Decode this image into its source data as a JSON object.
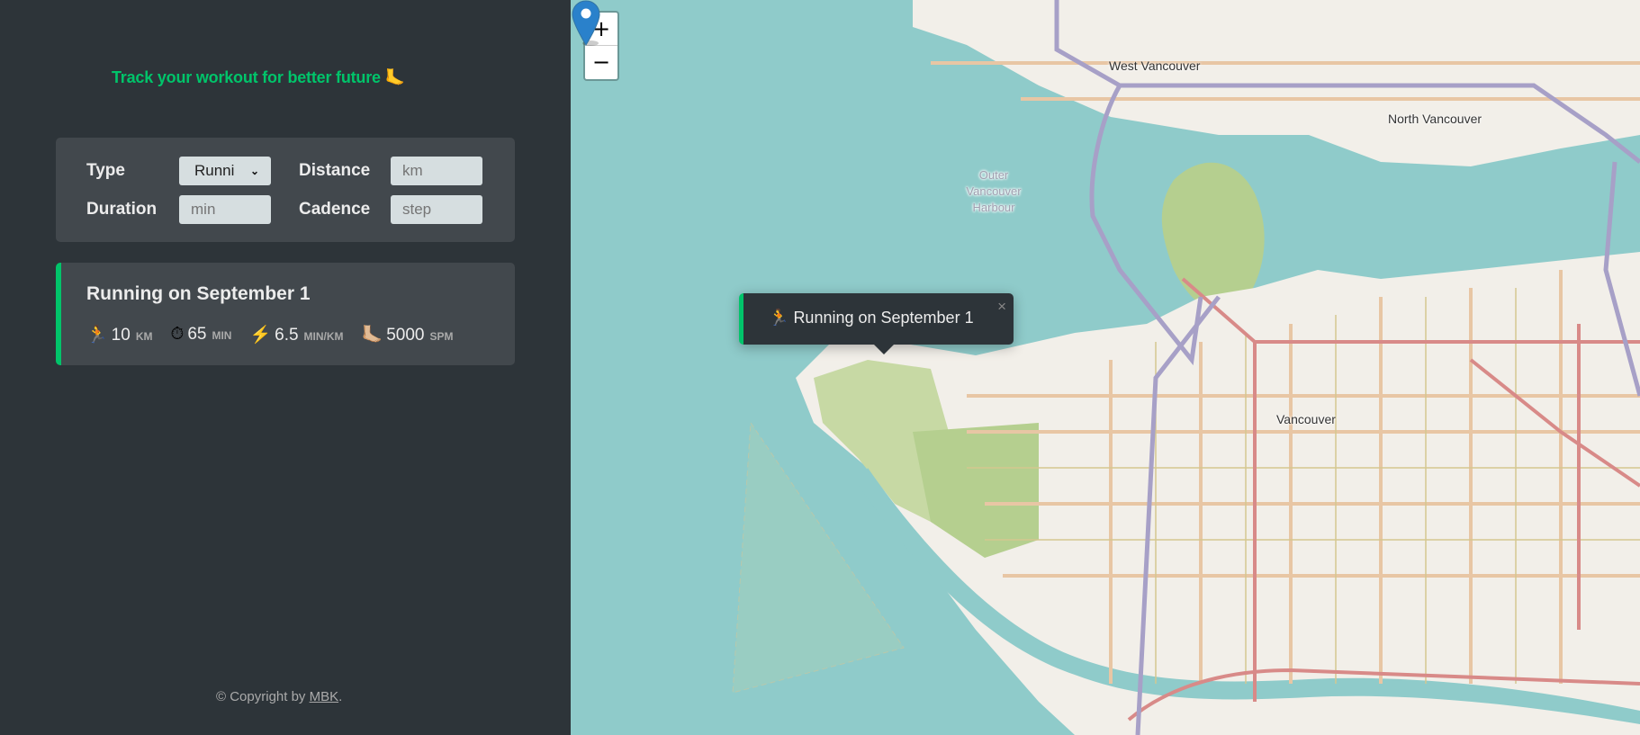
{
  "sidebar": {
    "tagline": "Track your workout for better future 🦶",
    "form": {
      "type_label": "Type",
      "type_value": "Runni",
      "distance_label": "Distance",
      "distance_placeholder": "km",
      "duration_label": "Duration",
      "duration_placeholder": "min",
      "cadence_label": "Cadence",
      "cadence_placeholder": "step"
    },
    "workouts": [
      {
        "title": "Running on September 1",
        "details": [
          {
            "icon": "🏃",
            "icon_name": "runner-icon",
            "value": "10",
            "unit": "km"
          },
          {
            "icon": "⏱",
            "icon_name": "stopwatch-icon",
            "value": "65",
            "unit": "min"
          },
          {
            "icon": "⚡️",
            "icon_name": "lightning-icon",
            "value": "6.5",
            "unit": "min/km"
          },
          {
            "icon": "🦶🏼",
            "icon_name": "foot-icon",
            "value": "5000",
            "unit": "spm"
          }
        ]
      }
    ],
    "copyright_prefix": "© Copyright by ",
    "copyright_link": "MBK",
    "copyright_suffix": "."
  },
  "map": {
    "zoom_in": "+",
    "zoom_out": "−",
    "labels": {
      "west_vancouver": "West Vancouver",
      "north_vancouver": "North Vancouver",
      "vancouver": "Vancouver",
      "outer_harbour_1": "Outer",
      "outer_harbour_2": "Vancouver",
      "outer_harbour_3": "Harbour"
    },
    "popup": {
      "icon": "🏃",
      "text": "Running on September 1",
      "close": "×"
    }
  },
  "colors": {
    "accent": "#00c46a",
    "sidebar_bg": "#2d3439",
    "card_bg": "#42484d",
    "water": "#8fcbca"
  }
}
